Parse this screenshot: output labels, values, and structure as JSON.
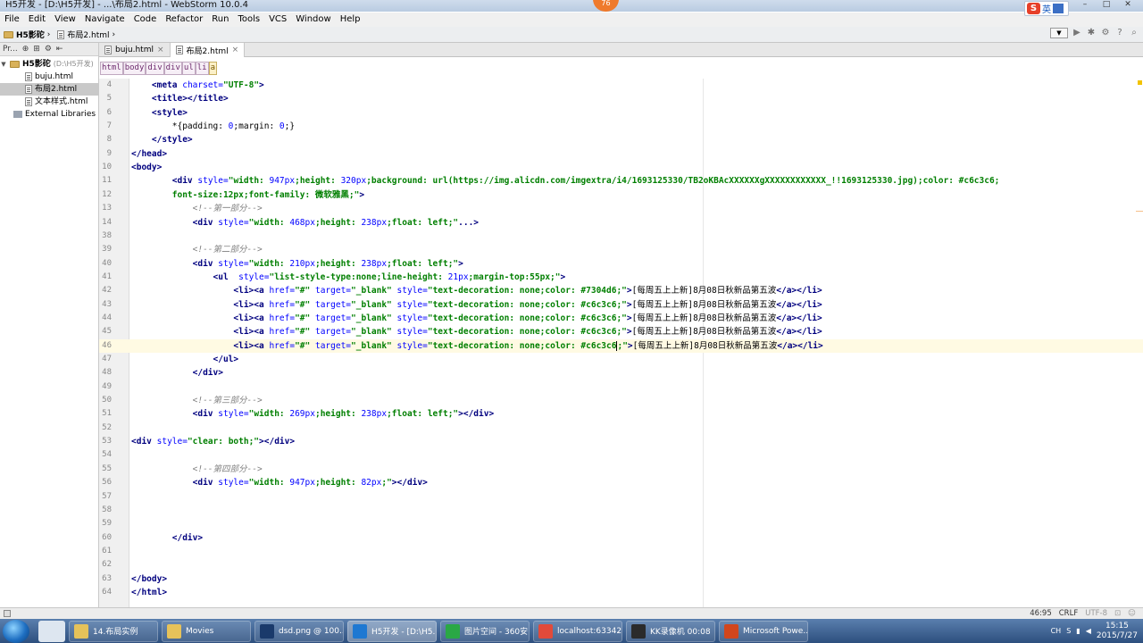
{
  "window": {
    "title": "H5开发 - [D:\\H5开发] - ...\\布局2.html - WebStorm 10.0.4",
    "badge": "76",
    "ime_label": "英"
  },
  "menu": [
    "File",
    "Edit",
    "View",
    "Navigate",
    "Code",
    "Refactor",
    "Run",
    "Tools",
    "VCS",
    "Window",
    "Help"
  ],
  "nav": {
    "project": "H5影砣",
    "file": "布局2.html"
  },
  "project_panel": {
    "tool_label": "Pr...",
    "root": "H5影砣",
    "root_path": "(D:\\H5开发)",
    "files": [
      "buju.html",
      "布局2.html",
      "文本样式.html"
    ],
    "libraries": "External Libraries"
  },
  "tabs": [
    {
      "label": "buju.html",
      "active": false
    },
    {
      "label": "布局2.html",
      "active": true
    }
  ],
  "tag_path": [
    "html",
    "body",
    "div",
    "div",
    "ul",
    "li",
    "a"
  ],
  "editor_lines": [
    {
      "n": "4",
      "html": "    <span class=\"t\">&lt;meta</span> <span class=\"a\">charset=</span><span class=\"s\">\"UTF-8\"</span><span class=\"t\">&gt;</span>"
    },
    {
      "n": "5",
      "html": "    <span class=\"t\">&lt;title&gt;&lt;/title&gt;</span>"
    },
    {
      "n": "6",
      "html": "    <span class=\"t\">&lt;style&gt;</span>"
    },
    {
      "n": "7",
      "html": "        *{padding: <span class=\"n\">0</span>;margin: <span class=\"n\">0</span>;}"
    },
    {
      "n": "8",
      "html": "    <span class=\"t\">&lt;/style&gt;</span>"
    },
    {
      "n": "9",
      "html": "<span class=\"t\">&lt;/head&gt;</span>"
    },
    {
      "n": "10",
      "html": "<span class=\"t\">&lt;body&gt;</span>"
    },
    {
      "n": "11",
      "html": "        <span class=\"t\">&lt;div</span> <span class=\"a\">style=</span><span class=\"s\">\"width: </span><span class=\"n\">947px</span><span class=\"s\">;height: </span><span class=\"n\">320px</span><span class=\"s\">;background: url(https://img.alicdn.com/imgextra/i4/1693125330/TB2oKBAcXXXXXXgXXXXXXXXXXXX_!!1693125330.jpg);color: #c6c3c6;</span>"
    },
    {
      "n": "12",
      "html": "        <span class=\"s\">font-size:12px;font-family: 微软雅黑;\"</span><span class=\"t\">&gt;</span>"
    },
    {
      "n": "13",
      "html": "            <span class=\"c\">&lt;!--第一部分--&gt;</span>"
    },
    {
      "n": "14",
      "html": "            <span class=\"t\">&lt;div</span> <span class=\"a\">style=</span><span class=\"s\">\"width: </span><span class=\"n\">468px</span><span class=\"s\">;height: </span><span class=\"n\">238px</span><span class=\"s\">;float: left;\"</span><span class=\"t\">...&gt;</span>"
    },
    {
      "n": "38",
      "html": ""
    },
    {
      "n": "39",
      "html": "            <span class=\"c\">&lt;!--第二部分--&gt;</span>"
    },
    {
      "n": "40",
      "html": "            <span class=\"t\">&lt;div</span> <span class=\"a\">style=</span><span class=\"s\">\"width: </span><span class=\"n\">210px</span><span class=\"s\">;height: </span><span class=\"n\">238px</span><span class=\"s\">;float: left;\"</span><span class=\"t\">&gt;</span>"
    },
    {
      "n": "41",
      "html": "                <span class=\"t\">&lt;ul</span>  <span class=\"a\">style=</span><span class=\"s\">\"list-style-type:none;line-height: </span><span class=\"n\">21px</span><span class=\"s\">;margin-top:55px;\"</span><span class=\"t\">&gt;</span>"
    },
    {
      "n": "42",
      "html": "                    <span class=\"t\">&lt;li&gt;&lt;a</span> <span class=\"a\">href=</span><span class=\"s\">\"#\"</span> <span class=\"a\">target=</span><span class=\"s\">\"_blank\"</span> <span class=\"a\">style=</span><span class=\"s\">\"text-decoration: none;color: #7304d6;\"</span><span class=\"t\">&gt;</span>[每周五上上新]8月08日秋新品第五波<span class=\"t\">&lt;/a&gt;&lt;/li&gt;</span>"
    },
    {
      "n": "43",
      "html": "                    <span class=\"t\">&lt;li&gt;&lt;a</span> <span class=\"a\">href=</span><span class=\"s\">\"#\"</span> <span class=\"a\">target=</span><span class=\"s\">\"_blank\"</span> <span class=\"a\">style=</span><span class=\"s\">\"text-decoration: none;color: #c6c3c6;\"</span><span class=\"t\">&gt;</span>[每周五上上新]8月08日秋新品第五波<span class=\"t\">&lt;/a&gt;&lt;/li&gt;</span>"
    },
    {
      "n": "44",
      "html": "                    <span class=\"t\">&lt;li&gt;&lt;a</span> <span class=\"a\">href=</span><span class=\"s\">\"#\"</span> <span class=\"a\">target=</span><span class=\"s\">\"_blank\"</span> <span class=\"a\">style=</span><span class=\"s\">\"text-decoration: none;color: #c6c3c6;\"</span><span class=\"t\">&gt;</span>[每周五上上新]8月08日秋新品第五波<span class=\"t\">&lt;/a&gt;&lt;/li&gt;</span>"
    },
    {
      "n": "45",
      "html": "                    <span class=\"t\">&lt;li&gt;&lt;a</span> <span class=\"a\">href=</span><span class=\"s\">\"#\"</span> <span class=\"a\">target=</span><span class=\"s\">\"_blank\"</span> <span class=\"a\">style=</span><span class=\"s\">\"text-decoration: none;color: #c6c3c6;\"</span><span class=\"t\">&gt;</span>[每周五上上新]8月08日秋新品第五波<span class=\"t\">&lt;/a&gt;&lt;/li&gt;</span>"
    },
    {
      "n": "46",
      "html": "                    <span class=\"t\">&lt;li&gt;&lt;a</span> <span class=\"a\">href=</span><span class=\"s\">\"#\"</span> <span class=\"a\">target=</span><span class=\"s\">\"_blank\"</span> <span class=\"a\">style=</span><span class=\"s\">\"text-decoration: none;color: #c6c3c6<i class=\"caret\"></i>;\"</span><span class=\"t\">&gt;</span>[每周五上上新]8月08日秋新品第五波<span class=\"t\">&lt;/a&gt;&lt;/li&gt;</span>"
    },
    {
      "n": "47",
      "html": "                <span class=\"t\">&lt;/ul&gt;</span>"
    },
    {
      "n": "48",
      "html": "            <span class=\"t\">&lt;/div&gt;</span>"
    },
    {
      "n": "49",
      "html": ""
    },
    {
      "n": "50",
      "html": "            <span class=\"c\">&lt;!--第三部分--&gt;</span>"
    },
    {
      "n": "51",
      "html": "            <span class=\"t\">&lt;div</span> <span class=\"a\">style=</span><span class=\"s\">\"width: </span><span class=\"n\">269px</span><span class=\"s\">;height: </span><span class=\"n\">238px</span><span class=\"s\">;float: left;\"</span><span class=\"t\">&gt;&lt;/div&gt;</span>"
    },
    {
      "n": "52",
      "html": ""
    },
    {
      "n": "53",
      "html": "<span class=\"t\">&lt;div</span> <span class=\"a\">style=</span><span class=\"s\">\"clear: both;\"</span><span class=\"t\">&gt;&lt;/div&gt;</span>"
    },
    {
      "n": "54",
      "html": ""
    },
    {
      "n": "55",
      "html": "            <span class=\"c\">&lt;!--第四部分--&gt;</span>"
    },
    {
      "n": "56",
      "html": "            <span class=\"t\">&lt;div</span> <span class=\"a\">style=</span><span class=\"s\">\"width: </span><span class=\"n\">947px</span><span class=\"s\">;height: </span><span class=\"n\">82px</span><span class=\"s\">;\"</span><span class=\"t\">&gt;&lt;/div&gt;</span>"
    },
    {
      "n": "57",
      "html": ""
    },
    {
      "n": "58",
      "html": ""
    },
    {
      "n": "59",
      "html": ""
    },
    {
      "n": "60",
      "html": "        <span class=\"t\">&lt;/div&gt;</span>"
    },
    {
      "n": "61",
      "html": ""
    },
    {
      "n": "62",
      "html": ""
    },
    {
      "n": "63",
      "html": "<span class=\"t\">&lt;/body&gt;</span>"
    },
    {
      "n": "64",
      "html": "<span class=\"t\">&lt;/html&gt;</span>"
    }
  ],
  "current_line": "46",
  "status": {
    "position": "46:95",
    "line_sep": "CRLF",
    "encoding": "UTF-8"
  },
  "taskbar": [
    {
      "label": "14.布局实例",
      "color": "#e6c25a"
    },
    {
      "label": "Movies",
      "color": "#e6c25a"
    },
    {
      "label": "dsd.png @ 100...",
      "color": "#1a3a6b"
    },
    {
      "label": "H5开发 - [D:\\H5...",
      "color": "#1e78d2"
    },
    {
      "label": "图片空间 - 360安...",
      "color": "#2aa845"
    },
    {
      "label": "localhost:63342/...",
      "color": "#e24a3a"
    },
    {
      "label": "KK录像机 00:08",
      "color": "#2b2b2b"
    },
    {
      "label": "Microsoft Powe...",
      "color": "#d2461d"
    }
  ],
  "clock": {
    "time": "15:15",
    "date": "2015/7/27"
  },
  "tray_label": "CH"
}
